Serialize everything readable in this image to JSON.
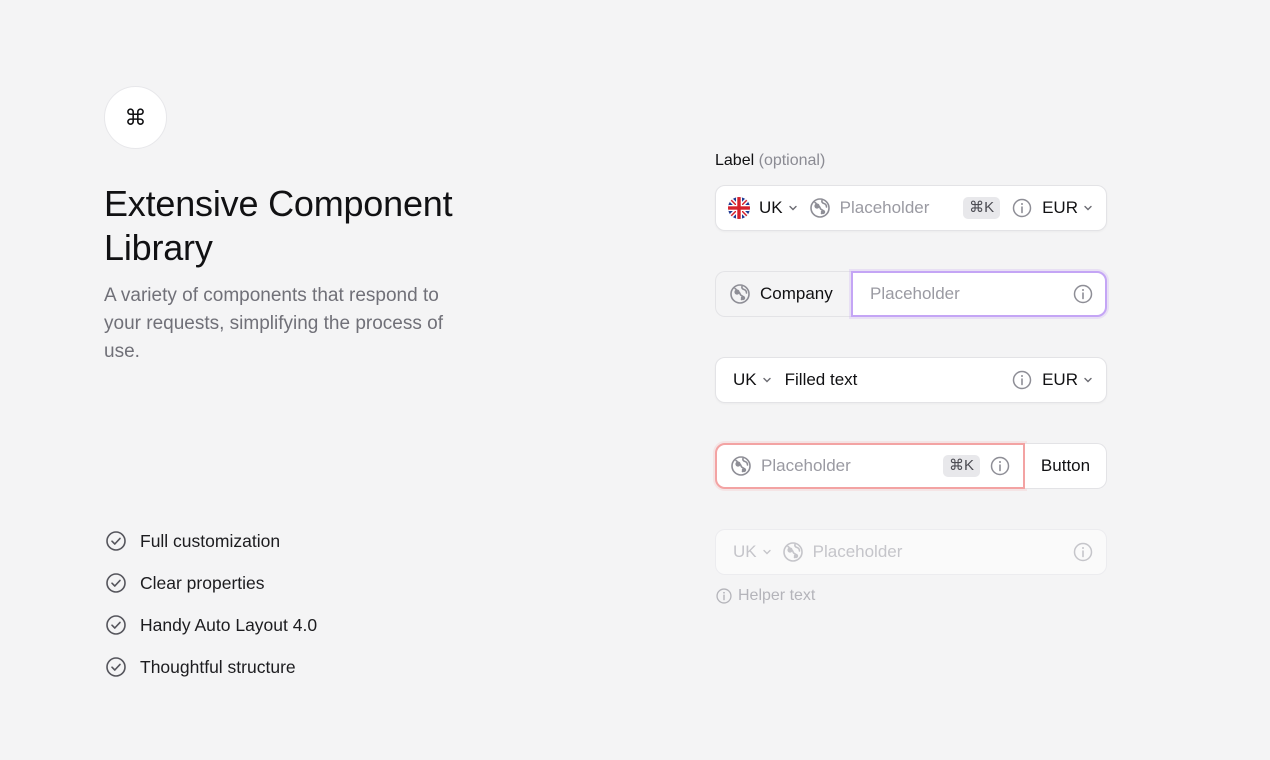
{
  "logo": {
    "glyph": "⌘"
  },
  "hero": {
    "title": "Extensive Component Library",
    "subtitle": "A variety of components that respond to your requests, simplifying the process of use."
  },
  "features": [
    {
      "label": "Full customization",
      "icon": "check-circle-icon"
    },
    {
      "label": "Clear properties",
      "icon": "check-circle-icon"
    },
    {
      "label": "Handy Auto Layout 4.0",
      "icon": "check-circle-icon"
    },
    {
      "label": "Thoughtful structure",
      "icon": "check-circle-icon"
    }
  ],
  "form": {
    "label": "Label",
    "label_optional": "(optional)",
    "field1": {
      "country": "UK",
      "placeholder": "Placeholder",
      "shortcut": "⌘K",
      "currency": "EUR"
    },
    "field2": {
      "addon": "Company",
      "placeholder": "Placeholder"
    },
    "field3": {
      "country": "UK",
      "value": "Filled text",
      "currency": "EUR"
    },
    "field4": {
      "placeholder": "Placeholder",
      "shortcut": "⌘K",
      "button": "Button"
    },
    "field5": {
      "country": "UK",
      "placeholder": "Placeholder"
    },
    "helper": "Helper text"
  },
  "colors": {
    "background": "#f4f4f5",
    "focus_border": "#c4a5f5",
    "error_border": "#f3a3a3"
  }
}
